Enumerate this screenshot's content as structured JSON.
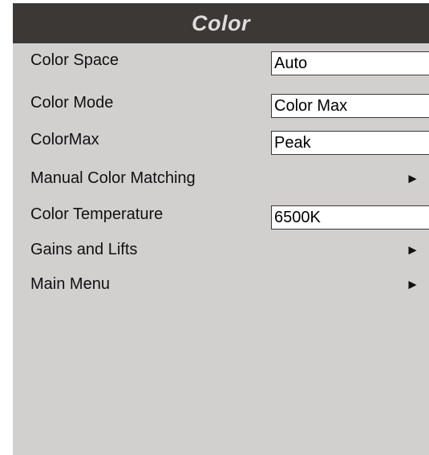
{
  "header": {
    "title": "Color"
  },
  "menu": {
    "items": [
      {
        "label": "Color Space",
        "value": "Auto"
      },
      {
        "label": "Color Mode",
        "value": "Color Max"
      },
      {
        "label": "ColorMax",
        "value": "Peak"
      },
      {
        "label": "Manual Color Matching",
        "arrow": "►"
      },
      {
        "label": "Color Temperature",
        "value": "6500K"
      },
      {
        "label": "Gains and Lifts",
        "arrow": "►"
      },
      {
        "label": "Main Menu",
        "arrow": "►"
      }
    ]
  },
  "icons": {
    "submenu_arrow": "right-triangle-icon"
  },
  "colors": {
    "title_bar": "#3b3836",
    "title_text": "#dedcdc",
    "panel": "#d2cfcf",
    "value_box": "#ffffff"
  }
}
